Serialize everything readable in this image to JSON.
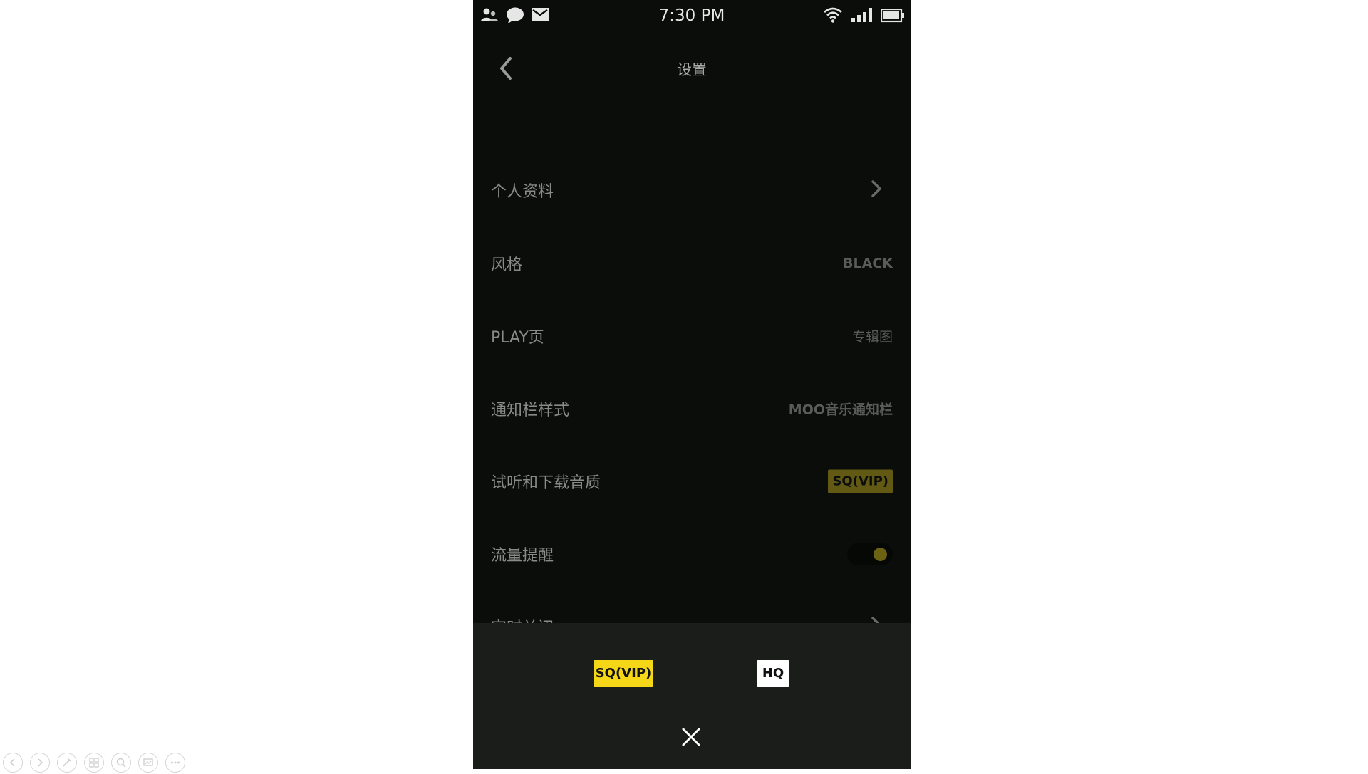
{
  "status_bar": {
    "time": "7:30 PM",
    "left_icons": [
      "contacts-icon",
      "message-bubble-icon",
      "mail-icon"
    ],
    "right_icons": [
      "wifi-icon",
      "signal-icon",
      "battery-icon"
    ]
  },
  "nav": {
    "title": "设置",
    "back_icon": "chevron-left-icon"
  },
  "settings": {
    "profile": {
      "label": "个人资料"
    },
    "style": {
      "label": "风格",
      "value": "BLACK"
    },
    "play_page": {
      "label": "PLAY页",
      "value": "专辑图"
    },
    "notification_style": {
      "label": "通知栏样式",
      "value": "MOO音乐通知栏"
    },
    "audio_quality": {
      "label": "试听和下载音质",
      "value": "SQ(VIP)"
    },
    "data_alert": {
      "label": "流量提醒",
      "enabled": true
    },
    "timer_close": {
      "label": "定时关闭"
    }
  },
  "quality_sheet": {
    "options": [
      "SQ(VIP)",
      "HQ"
    ],
    "selected": "SQ(VIP)",
    "close_icon": "close-icon"
  },
  "presentation_toolbar": {
    "icons": [
      "previous-icon",
      "next-icon",
      "pen-icon",
      "slides-icon",
      "zoom-icon",
      "screen-icon",
      "more-icon"
    ]
  },
  "colors": {
    "accent_yellow": "#f5d718",
    "dim_yellow": "#625a14",
    "background": "#0b0d0a",
    "sheet_background": "#1b1d1a"
  }
}
